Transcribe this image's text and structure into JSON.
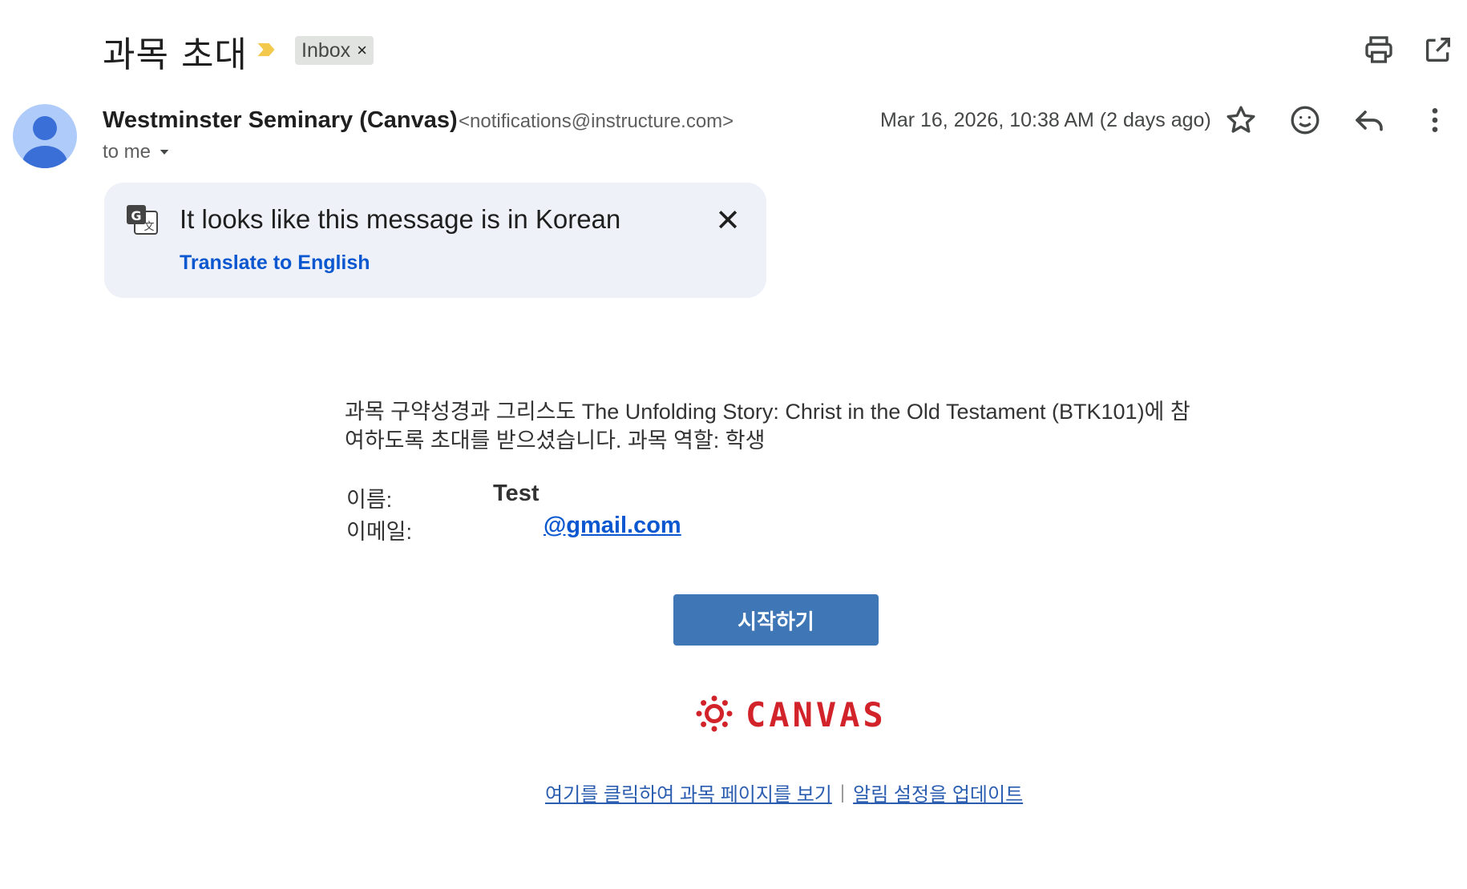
{
  "header": {
    "subject": "과목 초대",
    "label_chip": "Inbox",
    "label_remove": "×"
  },
  "sender": {
    "name": "Westminster Seminary (Canvas)",
    "email": "<notifications@instructure.com>",
    "recipient": "to me",
    "timestamp": "Mar 16, 2026, 10:38 AM (2 days ago)"
  },
  "translate": {
    "title": "It looks like this message is in Korean",
    "link": "Translate to English",
    "close": "✕"
  },
  "body": {
    "intro": "과목 구약성경과 그리스도 The Unfolding Story: Christ in the Old Testament (BTK101)에 참여하도록 초대를 받으셨습니다. 과목 역할: 학생",
    "name_label": "이름:",
    "name_value": "Test",
    "email_label": "이메일:",
    "email_value": "@gmail.com",
    "start_button": "시작하기",
    "brand": "CANVAS",
    "footer_link_1": "여기를 클릭하여 과목 페이지를 보기",
    "footer_separator": "|",
    "footer_link_2": "알림 설정을 업데이트"
  },
  "colors": {
    "accent_blue": "#0b57d0",
    "button_blue": "#3f76b5",
    "canvas_red": "#d2232a",
    "banner_bg": "#eef2f8",
    "importance_yellow": "#f2c94c"
  },
  "icons": {
    "importance": "importance-marker-icon",
    "print": "print-icon",
    "popout": "open-in-new-window-icon",
    "star": "star-icon",
    "emoji": "emoji-reaction-icon",
    "reply": "reply-icon",
    "more": "more-vertical-icon",
    "translate": "translate-icon",
    "dropdown": "dropdown-arrow-icon",
    "avatar": "default-avatar-icon",
    "canvas_logo": "canvas-logo-icon"
  }
}
